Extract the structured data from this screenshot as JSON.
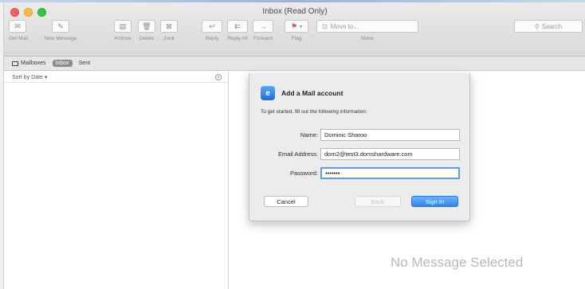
{
  "window": {
    "title": "Inbox (Read Only)"
  },
  "toolbar": {
    "get_mail": "Get Mail",
    "new_message": "New Message",
    "archive": "Archive",
    "delete": "Delete",
    "junk": "Junk",
    "reply": "Reply",
    "reply_all": "Reply All",
    "forward": "Forward",
    "flag": "Flag",
    "move_to_placeholder": "Move to...",
    "move": "Move",
    "search_placeholder": "Search"
  },
  "favorites": {
    "mailboxes": "Mailboxes",
    "inbox": "Inbox",
    "sent": "Sent"
  },
  "message_list": {
    "sort_label": "Sort by Date"
  },
  "reading_pane": {
    "empty_text": "No Message Selected"
  },
  "dialog": {
    "title": "Add a Mail account",
    "intro": "To get started, fill out the following information:",
    "name_label": "Name:",
    "name_value": "Dominic Sharoo",
    "email_label": "Email Address:",
    "email_value": "dom2@test3.domshardware.com",
    "password_label": "Password:",
    "password_value": "•••••••",
    "cancel": "Cancel",
    "back": "Back",
    "sign_in": "Sign In"
  },
  "colors": {
    "accent": "#2f84ef",
    "flag": "#e5484d"
  }
}
